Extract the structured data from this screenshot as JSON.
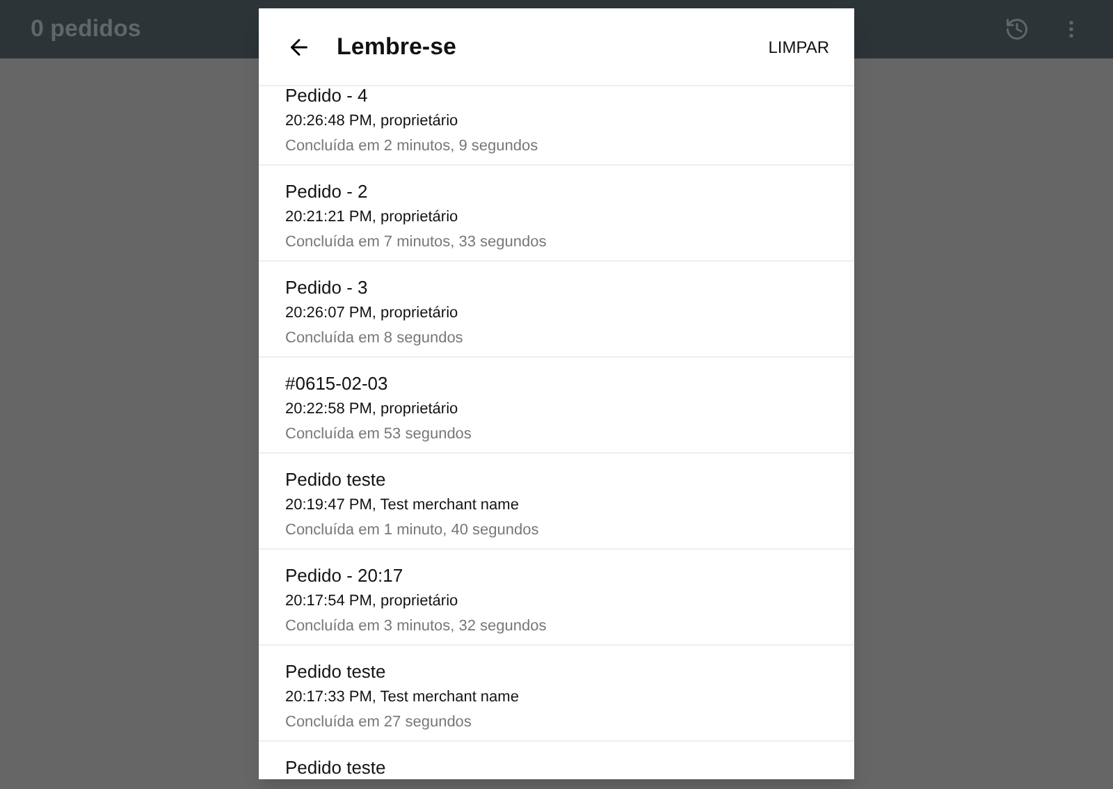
{
  "app_bar": {
    "title": "0 pedidos"
  },
  "dialog": {
    "title": "Lembre-se",
    "action": "LIMPAR",
    "items": [
      {
        "title": "Pedido - 4",
        "time": "20:26:48 PM, proprietário",
        "duration": "Concluída em 2 minutos, 9 segundos"
      },
      {
        "title": "Pedido - 2",
        "time": "20:21:21 PM, proprietário",
        "duration": "Concluída em 7 minutos, 33 segundos"
      },
      {
        "title": "Pedido - 3",
        "time": "20:26:07 PM, proprietário",
        "duration": "Concluída em 8 segundos"
      },
      {
        "title": "#0615-02-03",
        "time": "20:22:58 PM, proprietário",
        "duration": "Concluída em 53 segundos"
      },
      {
        "title": "Pedido teste",
        "time": "20:19:47 PM, Test merchant name",
        "duration": "Concluída em 1 minuto, 40 segundos"
      },
      {
        "title": "Pedido - 20:17",
        "time": "20:17:54 PM, proprietário",
        "duration": "Concluída em 3 minutos, 32 segundos"
      },
      {
        "title": "Pedido teste",
        "time": "20:17:33 PM, Test merchant name",
        "duration": "Concluída em 27 segundos"
      },
      {
        "title": "Pedido teste"
      }
    ]
  }
}
